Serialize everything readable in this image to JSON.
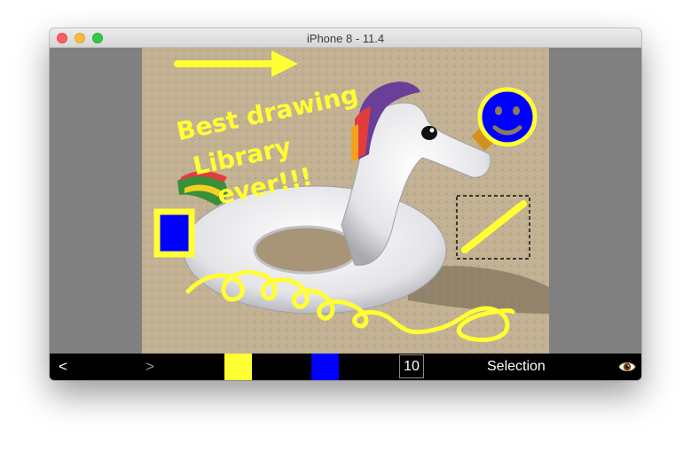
{
  "window": {
    "title": "iPhone 8 - 11.4"
  },
  "canvas": {
    "handwriting": [
      "Best drawing",
      "Library",
      "ever!!!"
    ]
  },
  "toolbar": {
    "undo_label": "<",
    "redo_label": ">",
    "stroke_color": "#ffff33",
    "fill_color": "#0000ff",
    "stroke_width": "10",
    "tool_label": "Selection",
    "preview_icon": "eye-icon"
  },
  "colors": {
    "annotation_yellow": "#ffff33",
    "annotation_blue": "#0000ff",
    "toolbar_bg": "#000000",
    "window_bg": "#808080"
  }
}
